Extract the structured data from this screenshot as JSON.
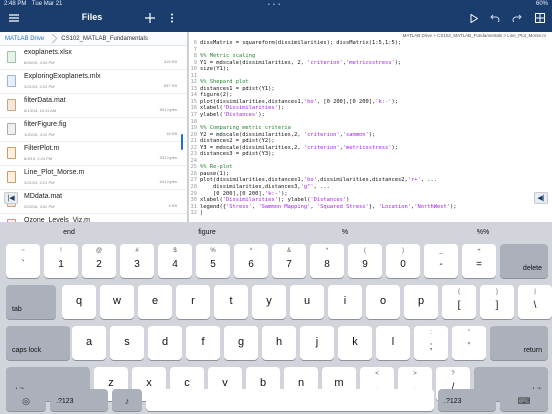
{
  "status": {
    "time": "2:48 PM",
    "date": "Tue Mar 21",
    "battery": "60%"
  },
  "toolbar": {
    "files_title": "Files",
    "left_icons": [
      "menu-icon"
    ],
    "mid_icons": [
      "plus-icon",
      "more-vertical-icon"
    ],
    "right_icons": [
      "run-icon",
      "undo-icon",
      "redo-icon",
      "grid-icon"
    ]
  },
  "file_browser": {
    "breadcrumb": [
      "MATLAB Drive",
      "CS102_MATLAB_Fundamentals"
    ],
    "files": [
      {
        "name": "exoplanets.xlsx",
        "meta": "8/26/19, 4:43 PM",
        "size": "316 KB",
        "type": "xlsx"
      },
      {
        "name": "ExploringExoplanets.mlx",
        "meta": "3/21/23, 2:22 PM",
        "size": "837 KB",
        "type": "mlx"
      },
      {
        "name": "filterData.mat",
        "meta": "6/13/14, 10:11 AM",
        "size": "501 bytes",
        "type": "mat"
      },
      {
        "name": "filterFigure.fig",
        "meta": "1/20/16, 4:12 PM",
        "size": "18 KB",
        "type": "fig"
      },
      {
        "name": "FilterPlot.m",
        "meta": "6/3/19, 2:24 PM",
        "size": "532 bytes",
        "type": "m"
      },
      {
        "name": "Line_Plot_Morse.m",
        "meta": "3/21/23, 2:21 PM",
        "size": "641 bytes",
        "type": "m"
      },
      {
        "name": "MDdata.mat",
        "meta": "2/23/16, 3:02 PM",
        "size": "3 KB",
        "type": "mat"
      },
      {
        "name": "Ozone_Levels_Viz.m",
        "meta": "",
        "size": "",
        "type": "m"
      }
    ]
  },
  "editor": {
    "breadcrumb": "MATLAB Drive > CS102_MATLAB_Fundamentals > Line_Plot_Morse.m",
    "lines": [
      {
        "n": "6",
        "segs": [
          {
            "t": "dissMatrix = squareform(dissimilarities); dissMatrix(1:5,1:5);",
            "c": "tx"
          }
        ]
      },
      {
        "n": "7",
        "segs": [
          {
            "t": "",
            "c": "tx"
          }
        ]
      },
      {
        "n": "8",
        "segs": [
          {
            "t": "%% Metric scaling",
            "c": "tx comment"
          }
        ]
      },
      {
        "n": "9",
        "segs": [
          {
            "t": "Y1 = mdscale(dissimilarities, 2, ",
            "c": "tx"
          },
          {
            "t": "'criterion'",
            "c": "tx str"
          },
          {
            "t": ",",
            "c": "tx"
          },
          {
            "t": "'metricsstress'",
            "c": "tx str"
          },
          {
            "t": ");",
            "c": "tx"
          }
        ]
      },
      {
        "n": "10",
        "segs": [
          {
            "t": "size(Y1);",
            "c": "tx"
          }
        ]
      },
      {
        "n": "11",
        "segs": [
          {
            "t": "",
            "c": "tx"
          }
        ]
      },
      {
        "n": "12",
        "segs": [
          {
            "t": "%% Shepard plot",
            "c": "tx comment"
          }
        ]
      },
      {
        "n": "13",
        "segs": [
          {
            "t": "distances1 = pdist(Y1);",
            "c": "tx"
          }
        ]
      },
      {
        "n": "14",
        "segs": [
          {
            "t": "figure(2);",
            "c": "tx"
          }
        ]
      },
      {
        "n": "15",
        "segs": [
          {
            "t": "plot(dissimilarities,distances1,",
            "c": "tx"
          },
          {
            "t": "'bo'",
            "c": "tx str"
          },
          {
            "t": ", [0 200],[0 200],",
            "c": "tx"
          },
          {
            "t": "'k:-'",
            "c": "tx str"
          },
          {
            "t": ");",
            "c": "tx"
          }
        ]
      },
      {
        "n": "16",
        "segs": [
          {
            "t": "xlabel(",
            "c": "tx"
          },
          {
            "t": "'Dissimilarities'",
            "c": "tx str"
          },
          {
            "t": ");",
            "c": "tx"
          }
        ]
      },
      {
        "n": "17",
        "segs": [
          {
            "t": "ylabel(",
            "c": "tx"
          },
          {
            "t": "'Distances'",
            "c": "tx str"
          },
          {
            "t": ");",
            "c": "tx"
          }
        ]
      },
      {
        "n": "18",
        "segs": [
          {
            "t": "",
            "c": "tx"
          }
        ]
      },
      {
        "n": "19",
        "segs": [
          {
            "t": "%% Comparing metric criteria",
            "c": "tx comment"
          }
        ]
      },
      {
        "n": "20",
        "segs": [
          {
            "t": "Y2 = mdscale(dissimilarities,2, ",
            "c": "tx"
          },
          {
            "t": "'criterion'",
            "c": "tx str"
          },
          {
            "t": ",",
            "c": "tx"
          },
          {
            "t": "'sammon'",
            "c": "tx str"
          },
          {
            "t": ");",
            "c": "tx"
          }
        ]
      },
      {
        "n": "21",
        "segs": [
          {
            "t": "distances2 = pdist(Y2);",
            "c": "tx"
          }
        ]
      },
      {
        "n": "22",
        "segs": [
          {
            "t": "Y3 = mdscale(dissimilarities,2, ",
            "c": "tx"
          },
          {
            "t": "'criterion'",
            "c": "tx str"
          },
          {
            "t": ",",
            "c": "tx"
          },
          {
            "t": "'metricsstress'",
            "c": "tx str"
          },
          {
            "t": ");",
            "c": "tx"
          }
        ]
      },
      {
        "n": "23",
        "segs": [
          {
            "t": "distances3 = pdist(Y3);",
            "c": "tx"
          }
        ]
      },
      {
        "n": "24",
        "segs": [
          {
            "t": "",
            "c": "tx"
          }
        ]
      },
      {
        "n": "25",
        "segs": [
          {
            "t": "%% Re-plot",
            "c": "tx comment"
          }
        ]
      },
      {
        "n": "26",
        "segs": [
          {
            "t": "pause(1);",
            "c": "tx"
          }
        ]
      },
      {
        "n": "27",
        "segs": [
          {
            "t": "plot(dissimilarities,distances1,",
            "c": "tx"
          },
          {
            "t": "'bo'",
            "c": "tx str"
          },
          {
            "t": ",dissimilarities,distances2,",
            "c": "tx"
          },
          {
            "t": "'r+'",
            "c": "tx str"
          },
          {
            "t": ", ...",
            "c": "tx"
          }
        ]
      },
      {
        "n": "28",
        "segs": [
          {
            "t": "    dissimilarities,distances3,",
            "c": "tx"
          },
          {
            "t": "'g^'",
            "c": "tx str"
          },
          {
            "t": ", ...",
            "c": "tx"
          }
        ]
      },
      {
        "n": "29",
        "segs": [
          {
            "t": "    [0 200],[0 200],",
            "c": "tx"
          },
          {
            "t": "'k:-'",
            "c": "tx str"
          },
          {
            "t": ");",
            "c": "tx"
          }
        ]
      },
      {
        "n": "30",
        "segs": [
          {
            "t": "xlabel(",
            "c": "tx"
          },
          {
            "t": "'Dissimilarities'",
            "c": "tx str"
          },
          {
            "t": "); ylabel(",
            "c": "tx"
          },
          {
            "t": "'Distances'",
            "c": "tx str"
          },
          {
            "t": ")",
            "c": "tx"
          }
        ]
      },
      {
        "n": "31",
        "segs": [
          {
            "t": "legend({",
            "c": "tx"
          },
          {
            "t": "'Stress'",
            "c": "tx str"
          },
          {
            "t": ", ",
            "c": "tx"
          },
          {
            "t": "'Sammon Mapping'",
            "c": "tx str"
          },
          {
            "t": ", ",
            "c": "tx"
          },
          {
            "t": "'Squared Stress'",
            "c": "tx str"
          },
          {
            "t": "}, ",
            "c": "tx"
          },
          {
            "t": "'Location'",
            "c": "tx str"
          },
          {
            "t": ",",
            "c": "tx"
          },
          {
            "t": "'NorthWest'",
            "c": "tx str"
          },
          {
            "t": ");",
            "c": "tx"
          }
        ]
      },
      {
        "n": "32",
        "segs": [
          {
            "t": "|",
            "c": "tx cursor"
          }
        ]
      }
    ]
  },
  "suggestions": [
    "end",
    "figure",
    "%",
    "%%"
  ],
  "keyboard": {
    "row1": [
      {
        "sym": "~",
        "main": "`"
      },
      {
        "sym": "!",
        "main": "1"
      },
      {
        "sym": "@",
        "main": "2"
      },
      {
        "sym": "#",
        "main": "3"
      },
      {
        "sym": "$",
        "main": "4"
      },
      {
        "sym": "%",
        "main": "5"
      },
      {
        "sym": "^",
        "main": "6"
      },
      {
        "sym": "&",
        "main": "7"
      },
      {
        "sym": "*",
        "main": "8"
      },
      {
        "sym": "(",
        "main": "9"
      },
      {
        "sym": ")",
        "main": "0"
      },
      {
        "sym": "_",
        "main": "-"
      },
      {
        "sym": "+",
        "main": "="
      }
    ],
    "delete_label": "delete",
    "tab_label": "tab",
    "row2": [
      "q",
      "w",
      "e",
      "r",
      "t",
      "y",
      "u",
      "i",
      "o",
      "p"
    ],
    "row2_extra": [
      {
        "sym": "{",
        "main": "["
      },
      {
        "sym": "}",
        "main": "]"
      },
      {
        "sym": "|",
        "main": "\\"
      }
    ],
    "caps_label": "caps lock",
    "row3": [
      "a",
      "s",
      "d",
      "f",
      "g",
      "h",
      "j",
      "k",
      "l"
    ],
    "row3_extra": [
      {
        "sym": ":",
        "main": ";"
      },
      {
        "sym": "”",
        "main": "'"
      }
    ],
    "return_label": "return",
    "shift_label": "shift",
    "row4": [
      "z",
      "x",
      "c",
      "v",
      "b",
      "n",
      "m"
    ],
    "row4_extra": [
      {
        "sym": "<",
        "main": ","
      },
      {
        "sym": ">",
        "main": "."
      },
      {
        "sym": "?",
        "main": "/"
      }
    ],
    "num_label": ".?123"
  }
}
